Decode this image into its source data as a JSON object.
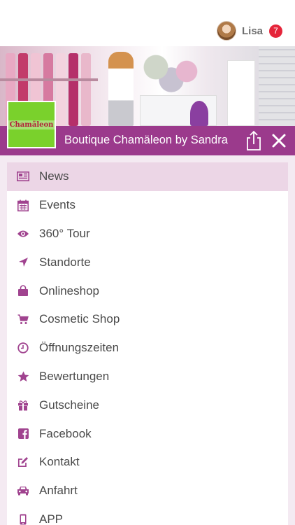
{
  "user": {
    "name": "Lisa",
    "notifications": "7"
  },
  "header": {
    "title": "Boutique Chamäleon by Sandra",
    "logo_text": "Chamäleon"
  },
  "colors": {
    "accent": "#9b3a8c",
    "icon": "#a0438f",
    "active_bg": "#ecd6e6",
    "badge": "#e5253a",
    "logo_bg": "#7ad12c"
  },
  "menu": {
    "items": [
      {
        "label": "News",
        "icon": "newspaper-icon",
        "active": true
      },
      {
        "label": "Events",
        "icon": "calendar-icon"
      },
      {
        "label": "360° Tour",
        "icon": "eye-icon"
      },
      {
        "label": "Standorte",
        "icon": "location-arrow-icon"
      },
      {
        "label": "Onlineshop",
        "icon": "shopping-bag-icon"
      },
      {
        "label": "Cosmetic Shop",
        "icon": "cart-icon"
      },
      {
        "label": "Öffnungszeiten",
        "icon": "clock-icon"
      },
      {
        "label": "Bewertungen",
        "icon": "star-icon"
      },
      {
        "label": "Gutscheine",
        "icon": "gift-icon"
      },
      {
        "label": "Facebook",
        "icon": "facebook-icon"
      },
      {
        "label": "Kontakt",
        "icon": "edit-icon"
      },
      {
        "label": "Anfahrt",
        "icon": "car-icon"
      },
      {
        "label": "APP",
        "icon": "phone-icon"
      }
    ]
  }
}
